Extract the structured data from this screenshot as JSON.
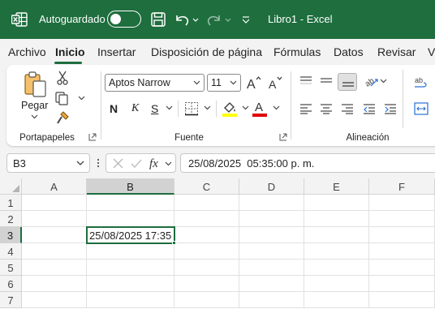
{
  "titlebar": {
    "autosave_label": "Autoguardado",
    "autosave_on": false,
    "document_title": "Libro1  -  Excel",
    "bg_color": "#1e6e3e"
  },
  "tabs": [
    {
      "label": "Archivo",
      "active": false
    },
    {
      "label": "Inicio",
      "active": true
    },
    {
      "label": "Insertar",
      "active": false
    },
    {
      "label": "Disposición de página",
      "active": false
    },
    {
      "label": "Fórmulas",
      "active": false
    },
    {
      "label": "Datos",
      "active": false
    },
    {
      "label": "Revisar",
      "active": false
    },
    {
      "label": "V",
      "active": false
    }
  ],
  "ribbon": {
    "clipboard": {
      "paste_label": "Pegar",
      "group_label": "Portapapeles"
    },
    "font": {
      "font_name": "Aptos Narrow",
      "font_size": "11",
      "bold_label": "N",
      "italic_label": "K",
      "underline_label": "S",
      "font_color_label": "A",
      "group_label": "Fuente",
      "highlight_color": "#ffff00",
      "font_color": "#e00000"
    },
    "alignment": {
      "group_label": "Alineación"
    }
  },
  "formula_bar": {
    "name_box": "B3",
    "formula": "25/08/2025  05:35:00 p. m."
  },
  "sheet": {
    "columns": [
      "A",
      "B",
      "C",
      "D",
      "E",
      "F"
    ],
    "rows": [
      "1",
      "2",
      "3",
      "4",
      "5",
      "6",
      "7"
    ],
    "selected_column": "B",
    "selected_row": "3",
    "active_cell_value": "25/08/2025 17:35"
  },
  "accent_color": "#1e6e3e"
}
